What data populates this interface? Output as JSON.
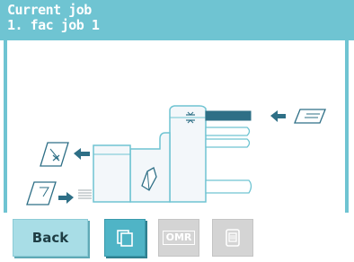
{
  "header": {
    "title": "Current job",
    "job_name": "1. fac job 1"
  },
  "footer": {
    "back_label": "Back",
    "omr_label": "OMR"
  },
  "colors": {
    "header_bg": "#6fc4d2",
    "accent": "#4fb4c6",
    "tray_active": "#2e6f86",
    "disabled": "#d4d4d4"
  },
  "icons": {
    "sheets_button": "multi-sheet-icon",
    "omr_button": "omr-icon",
    "scan_button": "scan-code-icon"
  }
}
